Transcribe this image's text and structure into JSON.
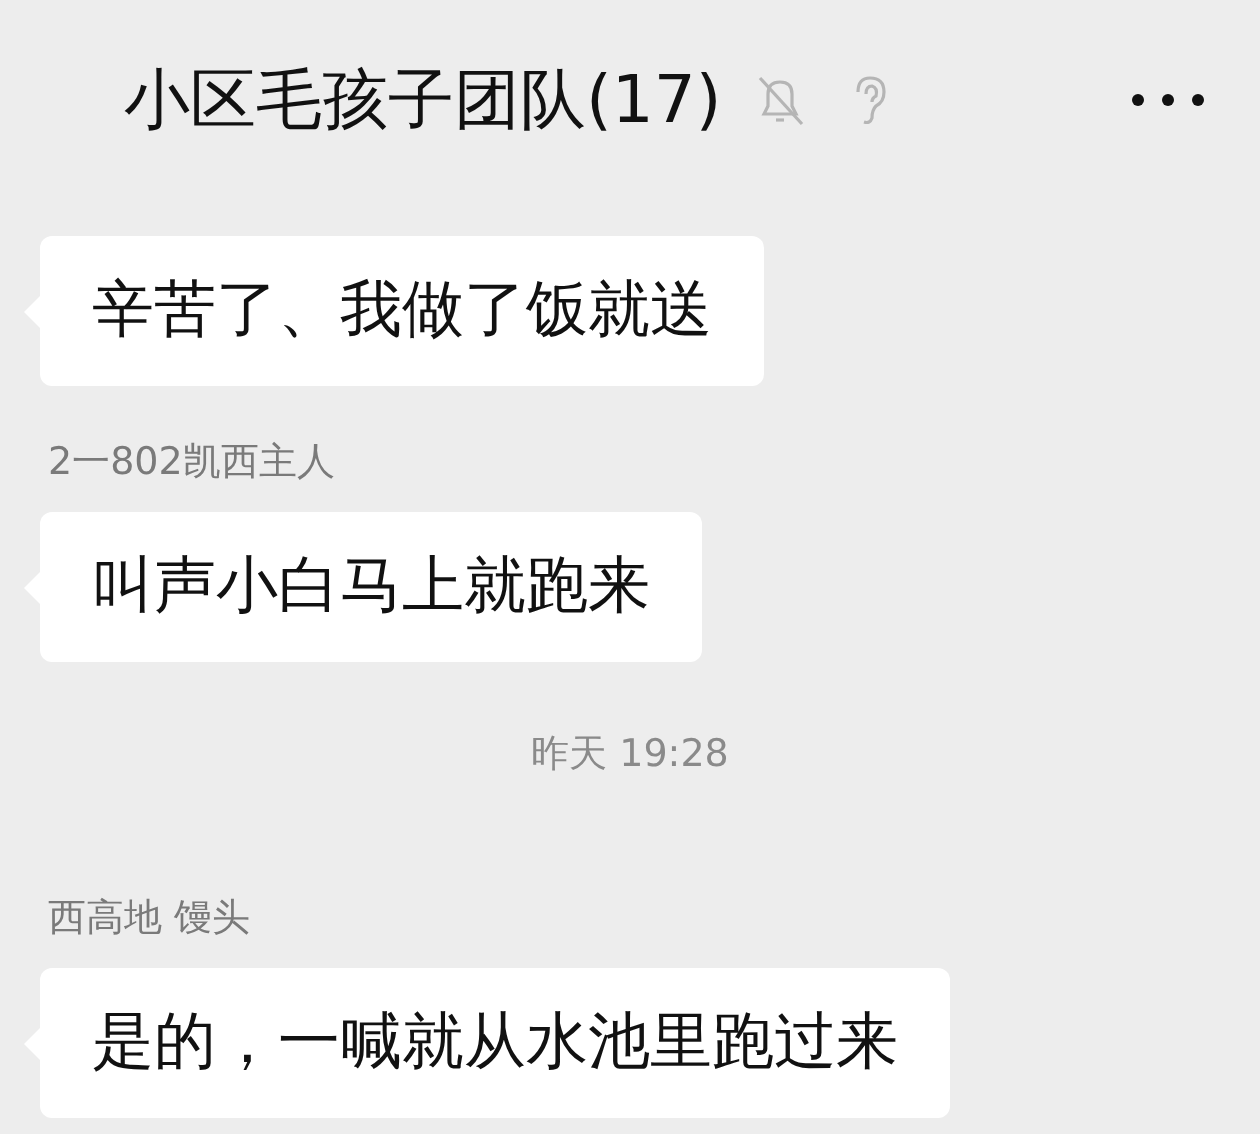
{
  "header": {
    "title": "小区毛孩子团队(17)",
    "muted": true
  },
  "messages": [
    {
      "kind": "message",
      "text": "辛苦了、我做了饭就送"
    },
    {
      "kind": "message",
      "sender": "2一802凯西主人",
      "text": "叫声小白马上就跑来"
    },
    {
      "kind": "time",
      "text": "昨天 19:28"
    },
    {
      "kind": "message",
      "sender": "西高地 馒头",
      "text": "是的，一喊就从水池里跑过来"
    }
  ]
}
